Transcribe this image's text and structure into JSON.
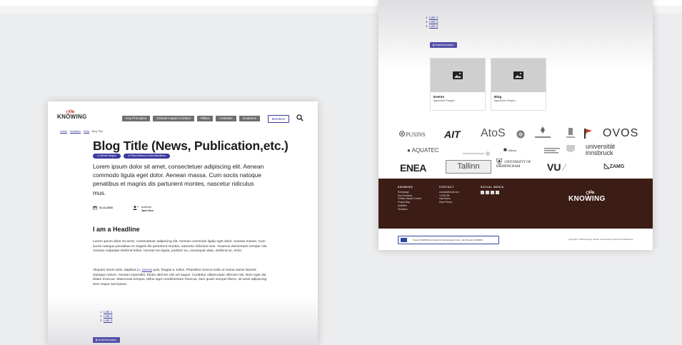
{
  "logo_text": "KNOWING",
  "left": {
    "nav": [
      "Key Principles",
      "Climate Impact Context",
      "Pillars",
      "Activities",
      "Guidance"
    ],
    "members_label": "Members",
    "breadcrumbs": [
      "Home",
      "Activities",
      "Blog",
      "Blog Title"
    ],
    "title": "Blog Title (News, Publication,etc.)",
    "tags": [
      "Climate Region",
      "Policy Makers & Administrations"
    ],
    "lead": "Lorem ipsum dolor sit amet, consectetuer adipiscing elit. Aenean commodo ligula eget dolor. Aenean massa. Cum sociis natoque penatibus et magnis dis parturient montes, nascetur ridiculus mus.",
    "date": "01.11.2023",
    "author_label": "Author/s",
    "author_name": "Jane Doe",
    "headline": "I am a Headline",
    "para1": "Lorem ipsum dolor sit amet, consectetuer adipiscing elit. Aenean commodo ligula eget dolor. Aenean massa. Cum sociis natoque penatibus et magnis dis parturient montes, nascetur ridiculus mus. Vivamus elementum semper nisi. Aenean vulputate eleifend tellus. Aenean leo ligula, porttitor eu, consequat vitae, eleifend ac, enim.",
    "para2_before": "Aliquam lorem ante, dapibus in, ",
    "para2_link": "viverra",
    "para2_after": " quis, feugiat a, tellus. Phasellus viverra nulla ut metus varius laoreet. Quisque rutrum. Aenean imperdiet. Etiam ultricies nisi vel augue. Curabitur ullamcorper ultricies nisi. Nam eget dui. Etiam rhoncus. Maecenas tempus, tellus eget condimentum rhoncus, sem quam semper libero, sit amet adipiscing sem neque sed ipsum.",
    "links": [
      "Link 1",
      "Link 2",
      "Link 3"
    ],
    "download_label": "Download paper"
  },
  "right": {
    "links": [
      "Link 1",
      "Link 2",
      "Link 3"
    ],
    "download_label": "Download paper",
    "cards": [
      {
        "title": "Events",
        "sub": "Agriculture Region"
      },
      {
        "title": "Blog",
        "sub": "Agriculture Region"
      }
    ],
    "partners": {
      "row1": [
        "PUSINS",
        "AIT",
        "AtoS",
        "OVOS"
      ],
      "row2": [
        "AQUATEC",
        "Tallinna",
        "universität innsbruck"
      ],
      "row3": [
        "ENEA",
        "Tallinn",
        "UNIVERSITY OF BIRMINGHAM",
        "VU",
        "ZAMG"
      ]
    },
    "footer": {
      "col1_head": "KNOWING",
      "col1_items": [
        "Homepage",
        "Key Principles",
        "Climate Impact Context",
        "Project Map",
        "Activities",
        "Guidance"
      ],
      "col2_head": "CONTACT",
      "col2_items": [
        "contact@email.com",
        "+1234745",
        "Impressum",
        "Data Privacy"
      ],
      "col3_head": "SOCIAL MEDIA",
      "logo": "KNOWING"
    },
    "eu_text": "Project KNOWING is funded by the European Union · EU Project 101056841",
    "copyright": "Copyright © 2023 Knowing domain. Powered By Colourd and WordPress."
  },
  "colors": {
    "accent": "#3d3aa0",
    "footer": "#3b1d16",
    "nav": "#6f6f6f"
  }
}
